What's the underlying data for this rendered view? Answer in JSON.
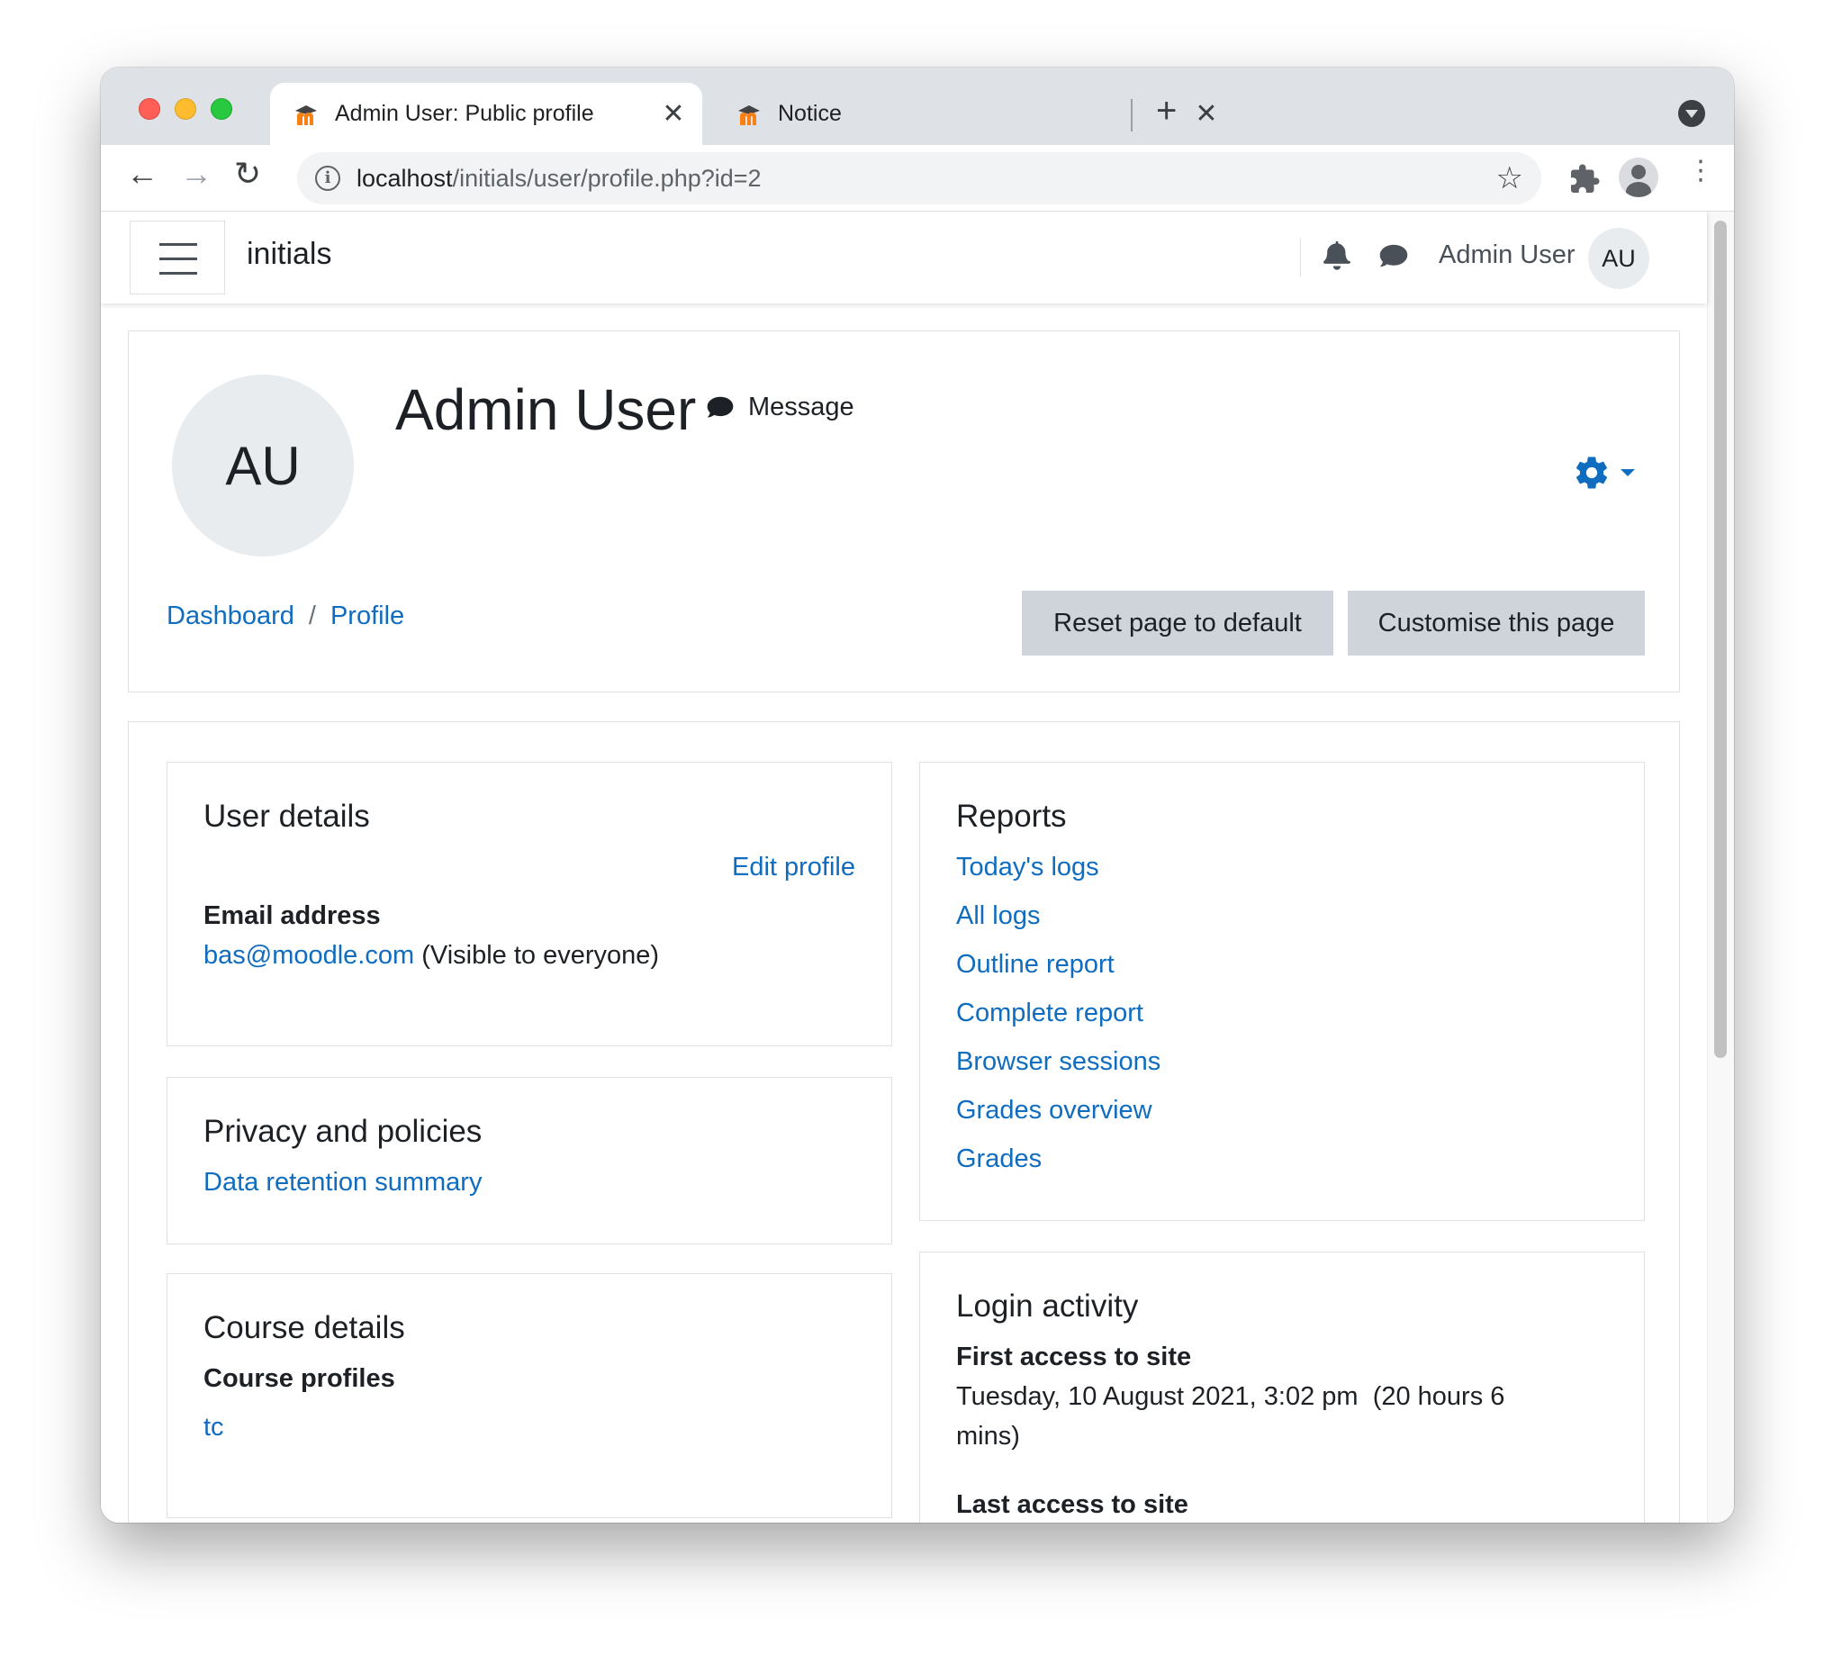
{
  "browser": {
    "tabs": [
      {
        "title": "Admin User: Public profile",
        "active": true
      },
      {
        "title": "Notice",
        "active": false
      }
    ],
    "url_host": "localhost",
    "url_path": "/initials/user/profile.php?id=2"
  },
  "navbar": {
    "site_name": "initials",
    "user_name": "Admin User",
    "user_initials": "AU"
  },
  "header": {
    "avatar_initials": "AU",
    "full_name": "Admin User",
    "message_label": "Message",
    "breadcrumb": [
      "Dashboard",
      "Profile"
    ],
    "breadcrumb_separator": "/",
    "reset_button": "Reset page to default",
    "customise_button": "Customise this page"
  },
  "user_details": {
    "title": "User details",
    "edit_profile": "Edit profile",
    "email_label": "Email address",
    "email": "bas@moodle.com",
    "email_visibility": "(Visible to everyone)"
  },
  "privacy": {
    "title": "Privacy and policies",
    "link": "Data retention summary"
  },
  "course_details": {
    "title": "Course details",
    "profiles_label": "Course profiles",
    "courses": [
      "tc"
    ]
  },
  "reports": {
    "title": "Reports",
    "links": [
      "Today's logs",
      "All logs",
      "Outline report",
      "Complete report",
      "Browser sessions",
      "Grades overview",
      "Grades"
    ]
  },
  "login_activity": {
    "title": "Login activity",
    "first_access_label": "First access to site",
    "first_access_value_line1": "Tuesday, 10 August 2021, 3:02 pm  (20 hours 6",
    "first_access_value_line2": "mins)",
    "last_access_label": "Last access to site"
  },
  "colors": {
    "link": "#0f6cbf",
    "button_secondary": "#ced4da",
    "avatar_bg": "#e9ecef",
    "moodle_orange": "#f98012"
  }
}
